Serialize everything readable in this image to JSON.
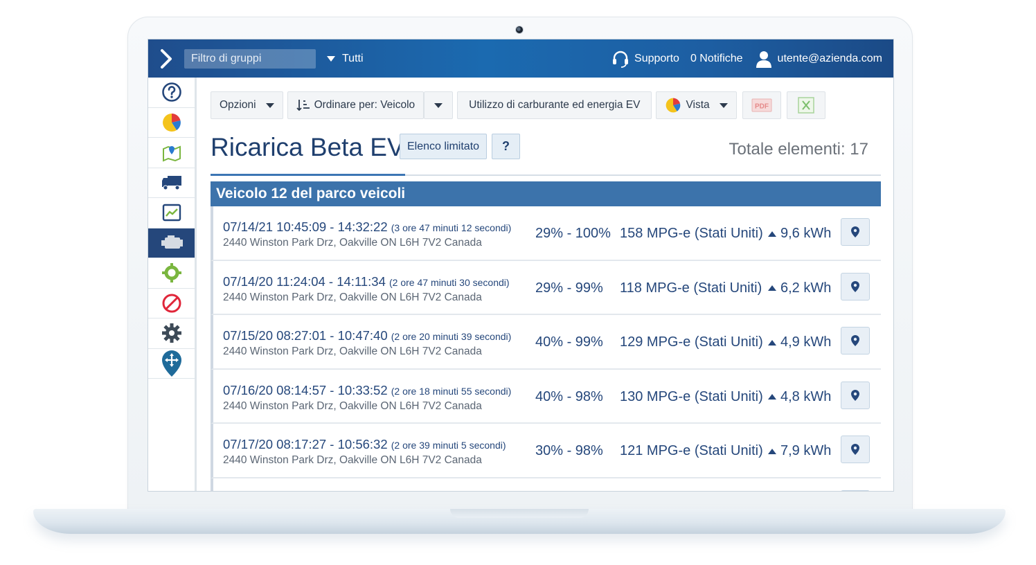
{
  "topbar": {
    "group_filter_placeholder": "Filtro di gruppi",
    "all_label": "Tutti",
    "support_label": "Supporto",
    "notifications_label": "0 Notifiche",
    "user_label": "utente@azienda.com"
  },
  "sidebar": {
    "items": [
      {
        "icon": "help-circle-icon"
      },
      {
        "icon": "pie-chart-icon"
      },
      {
        "icon": "map-icon"
      },
      {
        "icon": "truck-icon"
      },
      {
        "icon": "trend-chart-icon"
      },
      {
        "icon": "engine-icon",
        "active": true
      },
      {
        "icon": "rules-gear-icon"
      },
      {
        "icon": "exceptions-icon"
      },
      {
        "icon": "settings-gear-icon"
      },
      {
        "icon": "marketplace-pin-icon"
      }
    ]
  },
  "toolbar": {
    "options_label": "Opzioni",
    "sort_label": "Ordinare per: Veicolo",
    "report_label": "Utilizzo di carburante ed energia EV",
    "view_label": "Vista",
    "pdf_label": "PDF"
  },
  "page": {
    "title": "Ricarica Beta EV",
    "limited_button": "Elenco limitato",
    "help_button": "?",
    "total_label": "Totale elementi: 17"
  },
  "group": {
    "title": "Veicolo 12 del parco veicoli"
  },
  "rows": [
    {
      "when": "07/14/21 10:45:09 - 14:32:22",
      "duration": "(3 ore 47 minuti 12 secondi)",
      "address": "2440 Winston Park Drz, Oakville ON L6H 7V2 Canada",
      "charge": "29% - 100%",
      "mpg": "158 MPG-e (Stati Uniti)",
      "energy": "9,6 kWh"
    },
    {
      "when": "07/14/20 11:24:04 - 14:11:34",
      "duration": "(2 ore 47 minuti 30 secondi)",
      "address": "2440 Winston Park Drz, Oakville ON L6H 7V2 Canada",
      "charge": "29% - 99%",
      "mpg": "118 MPG-e (Stati Uniti)",
      "energy": "6,2 kWh"
    },
    {
      "when": "07/15/20 08:27:01 - 10:47:40",
      "duration": "(2 ore 20 minuti 39 secondi)",
      "address": "2440 Winston Park Drz, Oakville ON L6H 7V2 Canada",
      "charge": "40% - 99%",
      "mpg": "129 MPG-e (Stati Uniti)",
      "energy": "4,9 kWh"
    },
    {
      "when": "07/16/20 08:14:57 - 10:33:52",
      "duration": "(2 ore 18 minuti 55 secondi)",
      "address": "2440 Winston Park Drz, Oakville ON L6H 7V2 Canada",
      "charge": "40% - 98%",
      "mpg": "130 MPG-e (Stati Uniti)",
      "energy": "4,8 kWh"
    },
    {
      "when": "07/17/20 08:17:27 - 10:56:32",
      "duration": "(2 ore 39 minuti 5 secondi)",
      "address": "2440 Winston Park Drz, Oakville ON L6H 7V2 Canada",
      "charge": "30% - 98%",
      "mpg": "121 MPG-e (Stati Uniti)",
      "energy": "7,9 kWh"
    }
  ],
  "colors": {
    "brand_dark": "#25477b",
    "group_header": "#3c73ab",
    "topbar_start": "#1f4d8c",
    "topbar_mid": "#1b6ab0"
  }
}
